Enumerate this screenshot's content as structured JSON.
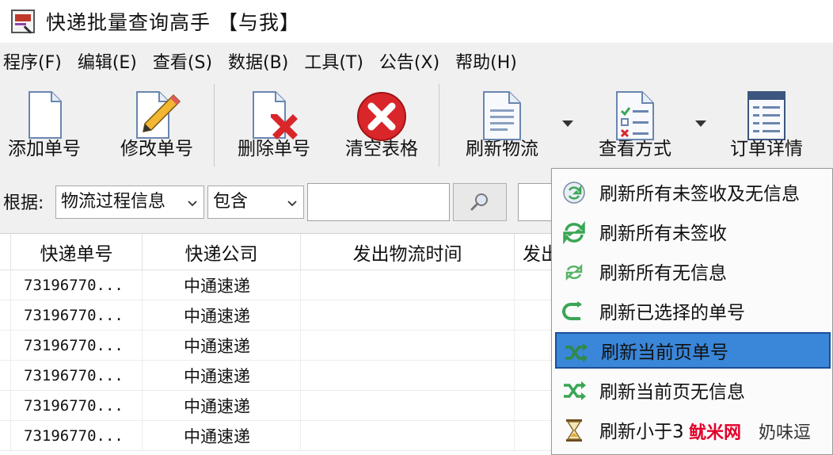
{
  "window": {
    "title": "快递批量查询高手 【与我】"
  },
  "menu": {
    "items": [
      {
        "label": "程序(F)"
      },
      {
        "label": "编辑(E)"
      },
      {
        "label": "查看(S)"
      },
      {
        "label": "数据(B)"
      },
      {
        "label": "工具(T)"
      },
      {
        "label": "公告(X)"
      },
      {
        "label": "帮助(H)"
      }
    ]
  },
  "toolbar": {
    "add_label": "添加单号",
    "edit_label": "修改单号",
    "delete_label": "删除单号",
    "clear_label": "清空表格",
    "refresh_label": "刷新物流",
    "view_label": "查看方式",
    "detail_label": "订单详情"
  },
  "filter": {
    "label": "根据:",
    "field_value": "物流过程信息",
    "op_value": "包含",
    "search_value": ""
  },
  "table": {
    "columns": [
      "快递单号",
      "快递公司",
      "发出物流时间",
      "发出"
    ],
    "rows": [
      {
        "tracking": "73196770...",
        "company": "中通速递",
        "time": ""
      },
      {
        "tracking": "73196770...",
        "company": "中通速递",
        "time": ""
      },
      {
        "tracking": "73196770...",
        "company": "中通速递",
        "time": ""
      },
      {
        "tracking": "73196770...",
        "company": "中通速递",
        "time": ""
      },
      {
        "tracking": "73196770...",
        "company": "中通速递",
        "time": ""
      },
      {
        "tracking": "73196770...",
        "company": "中通速递",
        "time": ""
      }
    ]
  },
  "refresh_menu": {
    "items": [
      {
        "label": "刷新所有未签收及无信息",
        "icon": "refresh-circle-icon"
      },
      {
        "label": "刷新所有未签收",
        "icon": "refresh-green-icon"
      },
      {
        "label": "刷新所有无信息",
        "icon": "refresh-small-icon"
      },
      {
        "label": "刷新已选择的单号",
        "icon": "refresh-selected-icon"
      },
      {
        "label": "刷新当前页单号",
        "icon": "shuffle-icon",
        "selected": true
      },
      {
        "label": "刷新当前页无信息",
        "icon": "shuffle-icon"
      },
      {
        "label": "刷新小于3",
        "icon": "hourglass-icon"
      }
    ]
  },
  "watermark": {
    "text1": "鱿米网",
    "text2": "奶味逗"
  },
  "colors": {
    "selection": "#3a86d8",
    "accent_green": "#3aa655",
    "delete_red": "#d9262a"
  }
}
